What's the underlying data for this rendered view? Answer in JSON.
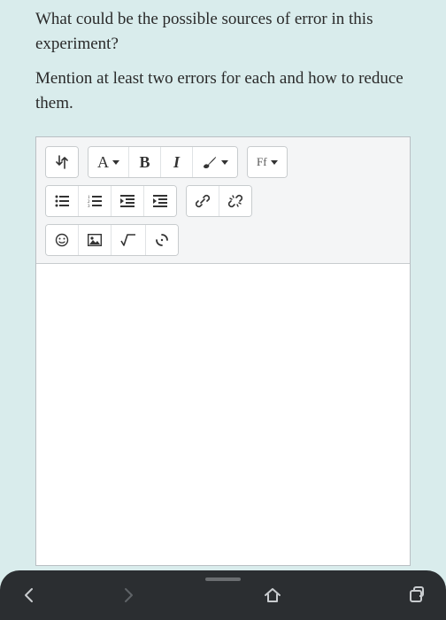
{
  "prompt": {
    "q1": "What could be the possible sources of error in this experiment?",
    "q2": "Mention at least two errors for each and how to reduce them."
  },
  "toolbar": {
    "font_size_label": "A",
    "bold_label": "B",
    "italic_label": "I",
    "font_family_label": "Ff"
  },
  "editor": {
    "value": ""
  }
}
